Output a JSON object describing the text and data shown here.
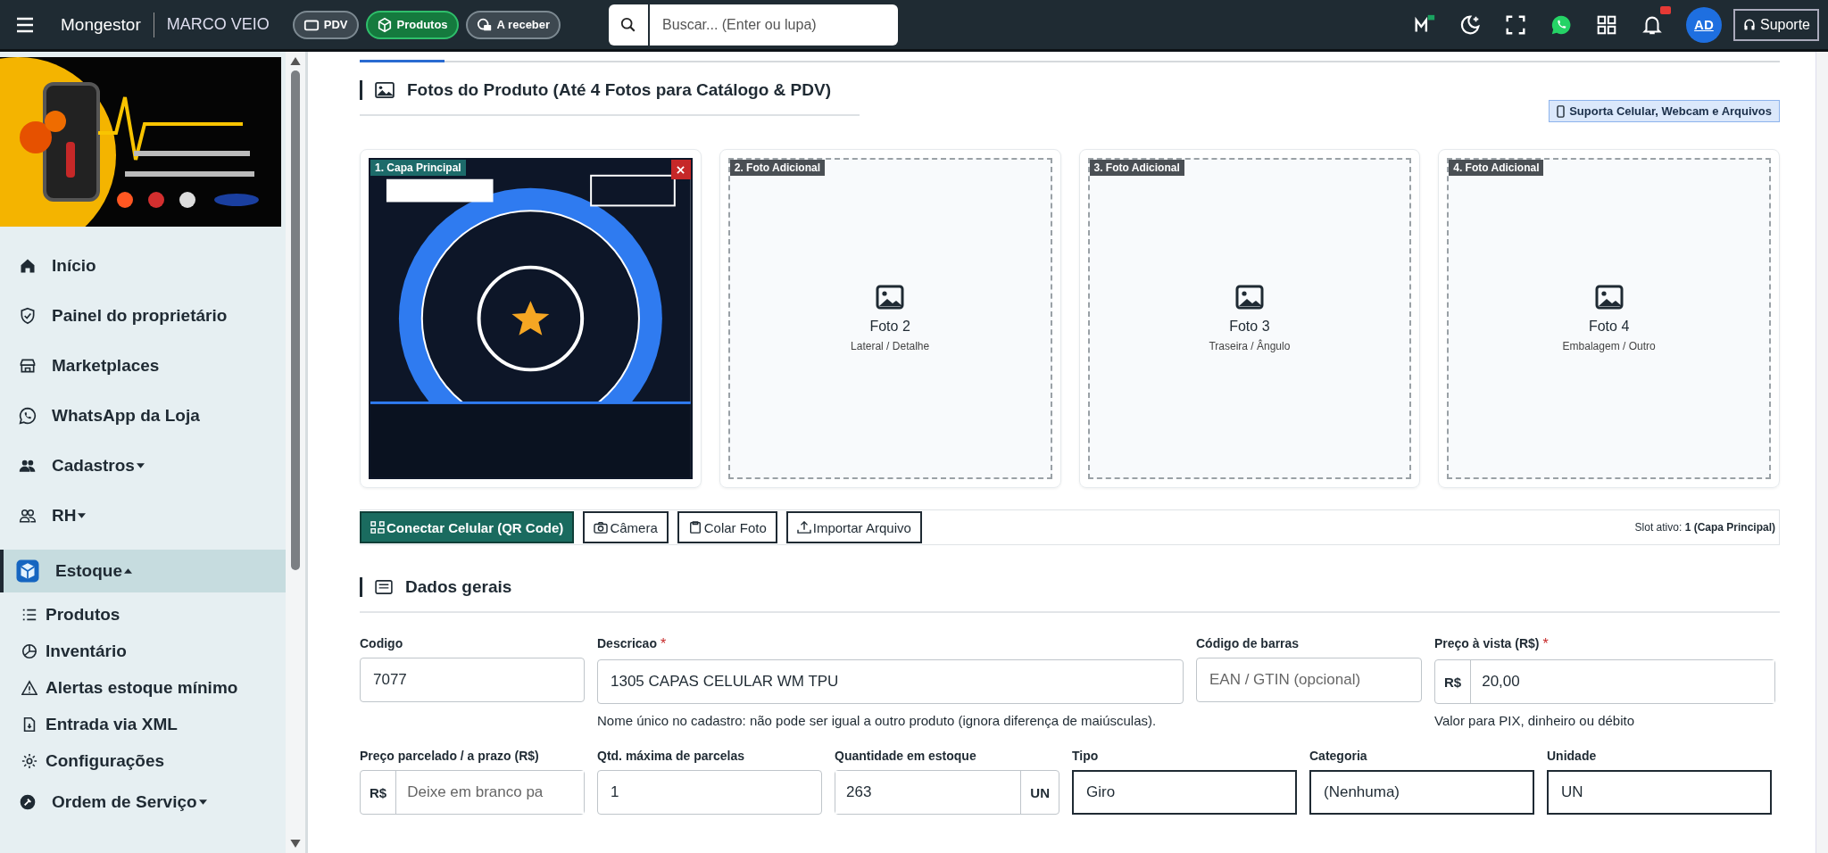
{
  "topbar": {
    "brand": "Mongestor",
    "store": "MARCO VEIO",
    "pills": [
      {
        "label": "PDV",
        "selected": false
      },
      {
        "label": "Produtos",
        "selected": true
      },
      {
        "label": "A receber",
        "selected": false
      }
    ],
    "search": {
      "placeholder": "Buscar... (Enter ou lupa)"
    },
    "notification_badge": true,
    "avatar": "AD",
    "support": "Suporte"
  },
  "sidebar": {
    "items": [
      {
        "label": "Início",
        "kind": "link",
        "selected": false
      },
      {
        "label": "Painel do proprietário",
        "kind": "link",
        "selected": false
      },
      {
        "label": "Marketplaces",
        "kind": "link",
        "selected": false
      },
      {
        "label": "WhatsApp da Loja",
        "kind": "link",
        "selected": false
      },
      {
        "label": "Cadastros",
        "kind": "group",
        "expanded": false,
        "selected": false
      },
      {
        "label": "RH",
        "kind": "group",
        "expanded": false,
        "selected": false
      },
      {
        "label": "Estoque",
        "kind": "group",
        "expanded": true,
        "selected": true,
        "children": [
          {
            "label": "Produtos"
          },
          {
            "label": "Inventário"
          },
          {
            "label": "Alertas estoque mínimo"
          },
          {
            "label": "Entrada via XML"
          },
          {
            "label": "Configurações"
          }
        ]
      },
      {
        "label": "Ordem de Serviço",
        "kind": "group",
        "expanded": false,
        "selected": false
      }
    ]
  },
  "photos": {
    "title": "Fotos do Produto (Até 4 Fotos para Catálogo & PDV)",
    "badge": "Suporta Celular, Webcam e Arquivos",
    "slots": [
      {
        "tag": "1. Capa Principal",
        "kind": "filled",
        "selected": true
      },
      {
        "tag": "2. Foto Adicional",
        "kind": "empty",
        "selected": false,
        "title": "Foto 2",
        "subtitle": "Lateral / Detalhe"
      },
      {
        "tag": "3. Foto Adicional",
        "kind": "empty",
        "selected": false,
        "title": "Foto 3",
        "subtitle": "Traseira / Ângulo"
      },
      {
        "tag": "4. Foto Adicional",
        "kind": "empty",
        "selected": false,
        "title": "Foto 4",
        "subtitle": "Embalagem / Outro"
      }
    ],
    "actions": [
      {
        "label": "Conectar Celular (QR Code)",
        "kind": "primary"
      },
      {
        "label": "Câmera",
        "kind": "outline"
      },
      {
        "label": "Colar Foto",
        "kind": "outline"
      },
      {
        "label": "Importar Arquivo",
        "kind": "outline"
      }
    ],
    "status": "Slot ativo: **1 (Capa Principal)**"
  },
  "general": {
    "title": "Dados gerais",
    "fields": [
      {
        "label": "Codigo",
        "kind": "text",
        "value": "7077"
      },
      {
        "label": "Descricao",
        "required_mark": "*",
        "kind": "text",
        "value": "1305 CAPAS CELULAR WM TPU",
        "help": "Nome único no cadastro: não pode ser igual a outro produto (ignora diferença de maiúsculas)."
      },
      {
        "label": "Código de barras",
        "kind": "text",
        "placeholder": "EAN / GTIN (opcional)"
      },
      {
        "label": "Preço à vista (R$)",
        "required_mark": "*",
        "kind": "prefix",
        "addon": "R$",
        "value": "20,00",
        "help": "Valor para PIX, dinheiro ou débito"
      },
      {
        "label": "Preço parcelado / a prazo (R$)",
        "kind": "prefix",
        "addon": "R$",
        "placeholder": "Deixe em branco pa"
      },
      {
        "label": "Qtd. máxima de parcelas",
        "kind": "text",
        "value": "1"
      },
      {
        "label": "Quantidade em estoque",
        "kind": "suffix",
        "addon": "UN",
        "value": "263"
      },
      {
        "label": "Tipo",
        "kind": "select",
        "value": "Giro"
      },
      {
        "label": "Categoria",
        "kind": "select",
        "value": "(Nenhuma)"
      },
      {
        "label": "Unidade",
        "kind": "select",
        "value": "UN"
      }
    ]
  }
}
